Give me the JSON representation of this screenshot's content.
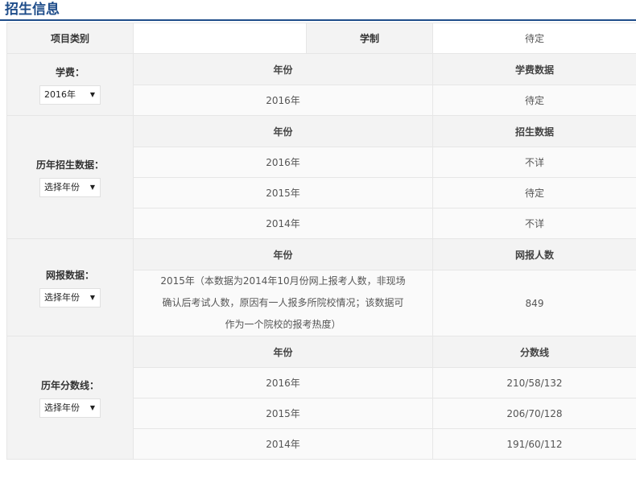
{
  "title": "招生信息",
  "row_project": {
    "label": "项目类别",
    "value": "",
    "system_label": "学制",
    "system_value": "待定"
  },
  "tuition": {
    "label": "学费：",
    "select": "2016年",
    "col_year": "年份",
    "col_data": "学费数据",
    "rows": [
      {
        "year": "2016年",
        "value": "待定"
      }
    ]
  },
  "enrollment": {
    "label": "历年招生数据：",
    "select": "选择年份",
    "col_year": "年份",
    "col_data": "招生数据",
    "rows": [
      {
        "year": "2016年",
        "value": "不详"
      },
      {
        "year": "2015年",
        "value": "待定"
      },
      {
        "year": "2014年",
        "value": "不详"
      }
    ]
  },
  "online": {
    "label": "网报数据：",
    "select": "选择年份",
    "col_year": "年份",
    "col_data": "网报人数",
    "note_line1": "2015年（本数据为2014年10月份网上报考人数，非现场",
    "note_line2": "确认后考试人数，原因有一人报多所院校情况；该数据可",
    "note_line3": "作为一个院校的报考热度）",
    "value": "849"
  },
  "scores": {
    "label": "历年分数线：",
    "select": "选择年份",
    "col_year": "年份",
    "col_data": "分数线",
    "rows": [
      {
        "year": "2016年",
        "value": "210/58/132"
      },
      {
        "year": "2015年",
        "value": "206/70/128"
      },
      {
        "year": "2014年",
        "value": "191/60/112"
      }
    ]
  }
}
